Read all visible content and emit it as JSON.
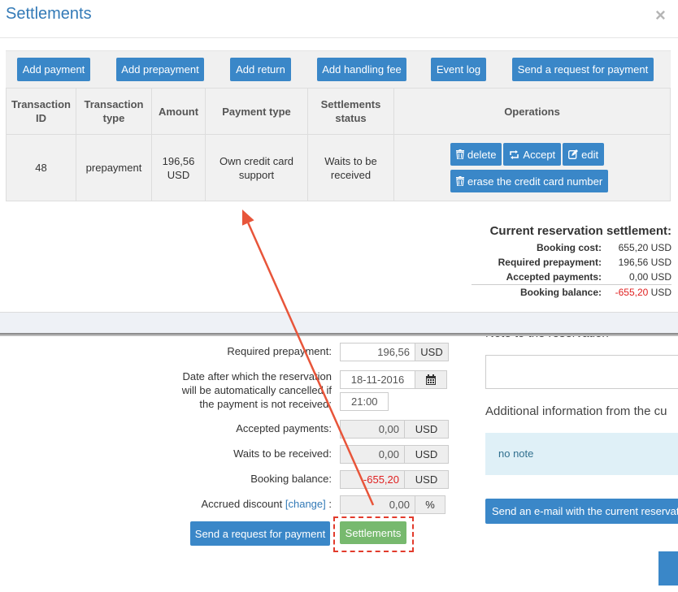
{
  "modal": {
    "title": "Settlements",
    "close_glyph": "×",
    "toolbar": [
      {
        "label": "Add payment"
      },
      {
        "label": "Add prepayment"
      },
      {
        "label": "Add return"
      },
      {
        "label": "Add handling fee"
      },
      {
        "label": "Event log"
      },
      {
        "label": "Send a request for payment"
      }
    ],
    "table": {
      "headers": [
        "Transaction ID",
        "Transaction type",
        "Amount",
        "Payment type",
        "Settlements status",
        "Operations"
      ],
      "rows": [
        {
          "id": "48",
          "type": "prepayment",
          "amount": "196,56 USD",
          "payment_type": "Own credit card support",
          "status": "Waits to be received",
          "operations": {
            "delete": "delete",
            "accept": "Accept",
            "edit": "edit",
            "erase": "erase the credit card number"
          }
        }
      ]
    },
    "summary": {
      "title": "Current reservation settlement:",
      "rows": [
        {
          "label": "Booking cost:",
          "value": "655,20 USD"
        },
        {
          "label": "Required prepayment:",
          "value": "196,56 USD"
        },
        {
          "label": "Accepted payments:",
          "value": "0,00 USD"
        }
      ],
      "balance": {
        "label": "Booking balance:",
        "amount": "-655,20",
        "currency": "USD"
      }
    }
  },
  "page": {
    "required_prepayment": {
      "label": "Required prepayment:",
      "value": "196,56",
      "currency": "USD"
    },
    "cancel_date": {
      "label_lines": [
        "Date after which the reservation",
        "will be automatically cancelled if",
        "the payment is not received:"
      ],
      "date": "18-11-2016",
      "time": "21:00"
    },
    "accepted_payments": {
      "label": "Accepted payments:",
      "value": "0,00",
      "currency": "USD"
    },
    "waits_to_be_received": {
      "label": "Waits to be received:",
      "value": "0,00",
      "currency": "USD"
    },
    "booking_balance": {
      "label": "Booking balance:",
      "value": "-655,20",
      "currency": "USD"
    },
    "accrued_discount": {
      "label": "Accrued discount",
      "change": "[change]",
      "colon": ":",
      "value": "0,00",
      "unit": "%"
    },
    "send_request_label": "Send a request for payment",
    "settlements_label": "Settlements",
    "note_title": "Note to the reservation",
    "additional_info_title": "Additional information from the cu",
    "no_note": "no note",
    "send_email_label": "Send an e-mail with the current reservatio"
  },
  "colors": {
    "primary": "#3a87c8",
    "success": "#77b96e",
    "danger": "#e02020",
    "annotation": "#e8553a"
  },
  "icons": {
    "delete": "trash-icon",
    "accept": "accept-icon",
    "edit": "edit-icon",
    "erase": "trash-icon",
    "date": "calendar-icon"
  }
}
